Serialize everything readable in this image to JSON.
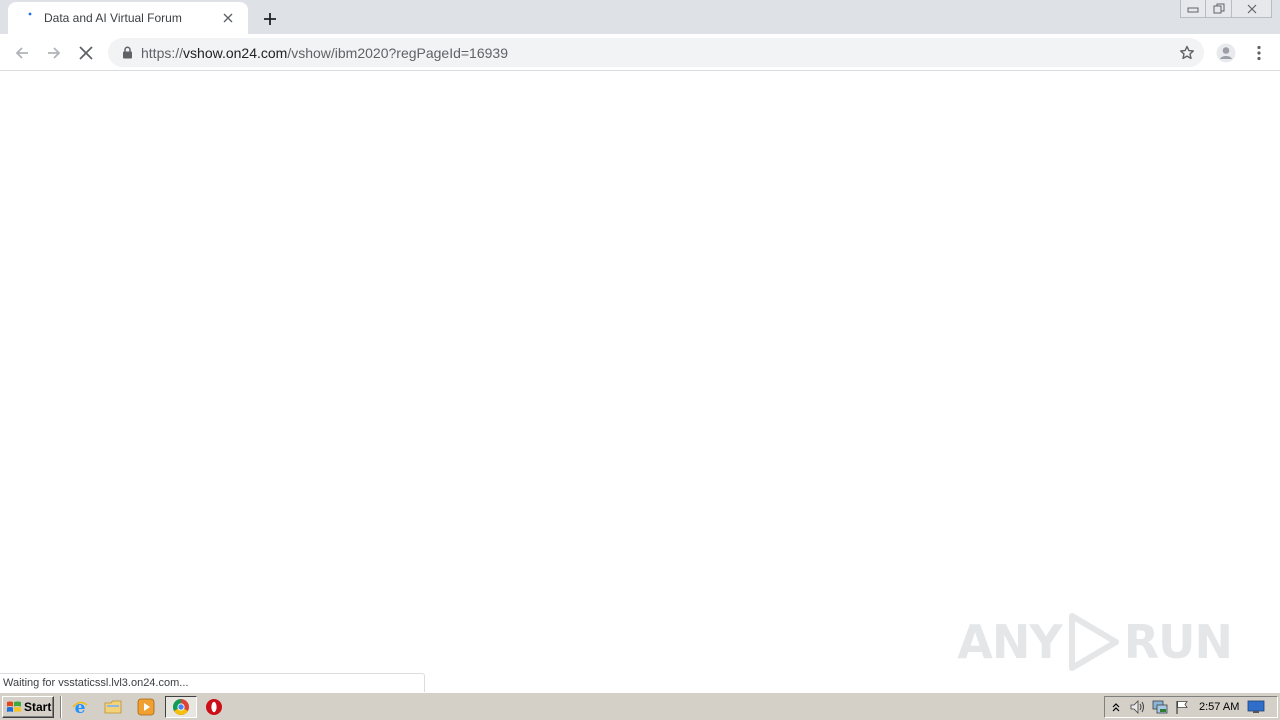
{
  "browser": {
    "tab": {
      "title": "Data and AI Virtual Forum"
    },
    "url": {
      "scheme": "https://",
      "host": "vshow.on24.com",
      "path": "/vshow/ibm2020?regPageId=16939"
    },
    "status": "Waiting for vsstaticssl.lvl3.on24.com..."
  },
  "watermark": {
    "text_left": "ANY",
    "text_right": "RUN"
  },
  "taskbar": {
    "start_label": "Start",
    "clock": "2:57 AM"
  },
  "colors": {
    "accent_blue": "#1a73e8",
    "ie_blue": "#1e90ff",
    "opera_red": "#cc0f16"
  }
}
